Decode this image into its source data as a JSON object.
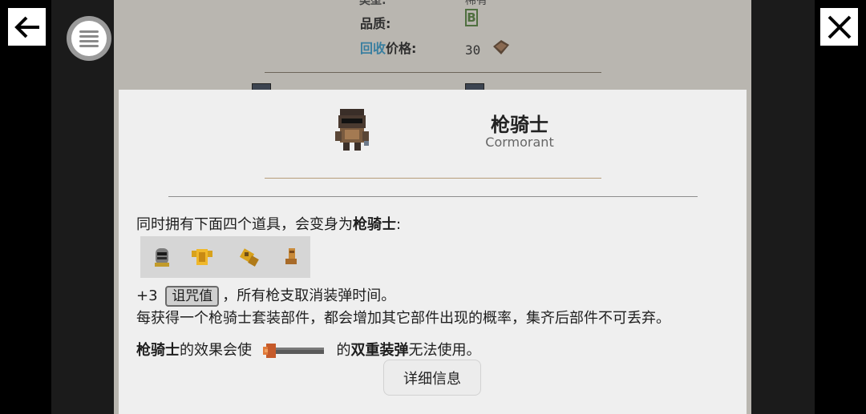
{
  "background": {
    "top_row_label": "类型:",
    "top_row_value": "稀有",
    "quality_label": "品质:",
    "quality_value": "B",
    "recycle_link": "回收",
    "recycle_label": "价格:",
    "recycle_value": "30"
  },
  "nav": {
    "back_icon": "arrow-left-icon",
    "menu_icon": "hamburger-menu-icon",
    "close_icon": "close-icon"
  },
  "dialog": {
    "title": "枪骑士",
    "subtitle": "Cormorant",
    "desc1_prefix": "同时拥有下面四个道具，会变身为",
    "desc1_bold": "枪骑士",
    "desc1_suffix": ":",
    "items": [
      "helmet",
      "armor",
      "gauntlet",
      "boot"
    ],
    "curse_prefix": "+3",
    "curse_tag": "诅咒值",
    "curse_suffix": "，所有枪支取消装弹时间。",
    "desc3": "每获得一个枪骑士套装部件，都会增加其它部件出现的概率，集齐后部件不可丢弃。",
    "desc4_bold1": "枪骑士",
    "desc4_mid": "的效果会使",
    "desc4_mid2": "的",
    "desc4_bold2": "双重装弹",
    "desc4_suffix": "无法使用。",
    "detail_button": "详细信息"
  },
  "colors": {
    "accent_blue": "#3a7fa0",
    "quality_green": "#4f6f3f",
    "gold_rule": "#b79d7a"
  }
}
